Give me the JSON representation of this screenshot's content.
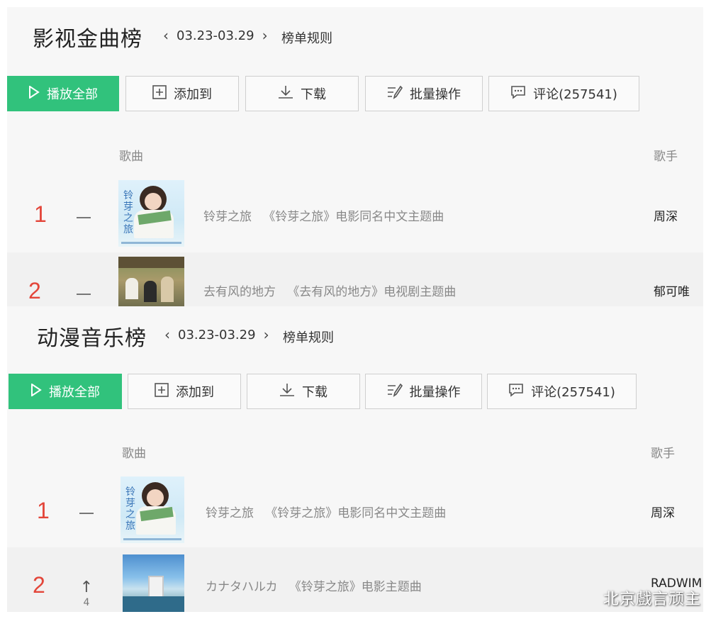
{
  "charts": [
    {
      "title": "影视金曲榜",
      "date_range": "03.23-03.29",
      "rules_label": "榜单规则",
      "buttons": {
        "play_all": "播放全部",
        "add_to": "添加到",
        "download": "下载",
        "batch": "批量操作",
        "comments": "评论(257541)"
      },
      "columns": {
        "song": "歌曲",
        "singer": "歌手"
      },
      "rows": [
        {
          "rank": "1",
          "trend": "—",
          "song": "铃芽之旅",
          "desc": "《铃芽之旅》电影同名中文主题曲",
          "singer": "周深",
          "cover": "suzume",
          "cover_text": "铃芽之旅"
        },
        {
          "rank": "2",
          "trend": "—",
          "song": "去有风的地方",
          "desc": "《去有风的地方》电视剧主题曲",
          "singer": "郁可唯",
          "cover": "wind"
        }
      ]
    },
    {
      "title": "动漫音乐榜",
      "date_range": "03.23-03.29",
      "rules_label": "榜单规则",
      "buttons": {
        "play_all": "播放全部",
        "add_to": "添加到",
        "download": "下载",
        "batch": "批量操作",
        "comments": "评论(257541)"
      },
      "columns": {
        "song": "歌曲",
        "singer": "歌手"
      },
      "rows": [
        {
          "rank": "1",
          "trend": "—",
          "song": "铃芽之旅",
          "desc": "《铃芽之旅》电影同名中文主题曲",
          "singer": "周深",
          "cover": "suzume",
          "cover_text": "铃芽之旅"
        },
        {
          "rank": "2",
          "trend": "↑",
          "trend_value": "4",
          "song": "カナタハルカ",
          "desc": "《铃芽之旅》电影主题曲",
          "singer": "RADWIM",
          "cover": "sky"
        }
      ]
    }
  ],
  "watermark": "北京戲言顽主",
  "colors": {
    "accent": "#31c27c",
    "rank": "#e3463a"
  },
  "icons": {
    "play": "play-icon",
    "add": "plus-square-icon",
    "download": "download-icon",
    "batch": "list-edit-icon",
    "comment": "comment-icon"
  }
}
